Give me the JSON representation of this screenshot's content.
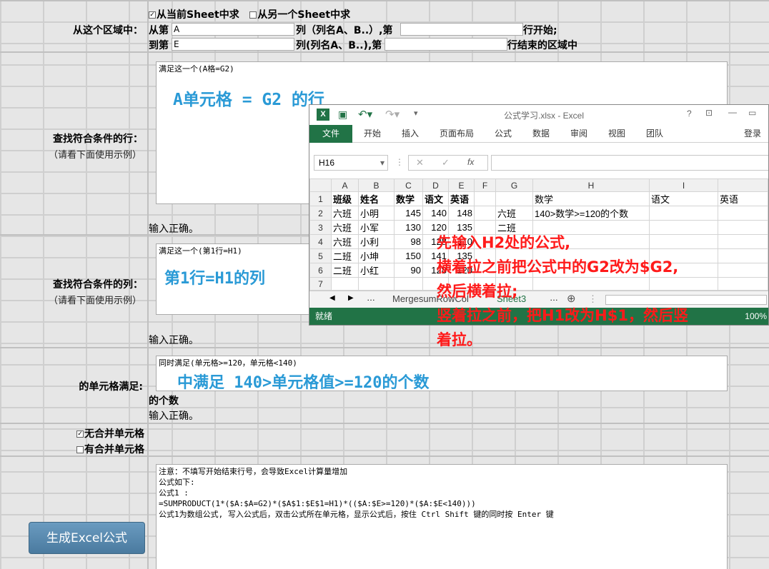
{
  "range": {
    "label": "从这个区域中：",
    "cb_current": "从当前Sheet中求",
    "cb_other": "从另一个Sheet中求",
    "from_prefix": "从第",
    "from_col": "A",
    "col_suffix_1": "列（列名A、B..）,第",
    "row_start": "行开始;",
    "to_prefix": "到第",
    "to_col": "E",
    "col_suffix_2": "列(列名A、B..),第",
    "row_end": "行结束的区域中"
  },
  "rows": {
    "label": "查找符合条件的行：",
    "hint": "（请看下面使用示例）",
    "textarea": "满足这一个(A格=G2)",
    "example": "A单元格 = G2 的行",
    "status": "输入正确。"
  },
  "cols": {
    "label": "查找符合条件的列：",
    "hint": "（请看下面使用示例）",
    "textarea": "满足这一个(第1行=H1)",
    "example": "第1行=H1的列",
    "status": "输入正确。"
  },
  "cells": {
    "label": "的单元格满足:",
    "textarea": "同时满足(单元格>=120，单元格<140)",
    "example": "中满足 140>单元格值>=120的个数",
    "count_label": "的个数",
    "status": "输入正确。"
  },
  "merge": {
    "no_merge": "无合并单元格",
    "has_merge": "有合并单元格"
  },
  "output": {
    "text": "注意：不填写开始结束行号，会导致Excel计算量增加\n公式如下:\n公式1 :\n=SUMPRODUCT(1*($A:$A=G2)*($A$1:$E$1=H1)*(($A:$E>=120)*($A:$E<140)))\n公式1为数组公式, 写入公式后，双击公式所在单元格，显示公式后，按住 Ctrl Shift 键的同时按 Enter 键",
    "button": "生成Excel公式"
  },
  "excel": {
    "title": "公式学习.xlsx - Excel",
    "tabs": [
      "文件",
      "开始",
      "插入",
      "页面布局",
      "公式",
      "数据",
      "审阅",
      "视图",
      "团队"
    ],
    "login": "登录",
    "namebox": "H16",
    "col_headers": [
      "A",
      "B",
      "C",
      "D",
      "E",
      "F",
      "G",
      "H",
      "I",
      ""
    ],
    "grid": [
      [
        "1",
        "班级",
        "姓名",
        "数学",
        "语文",
        "英语",
        "",
        "",
        "数学",
        "语文",
        "英语"
      ],
      [
        "2",
        "六班",
        "小明",
        "145",
        "140",
        "148",
        "",
        "六班",
        "140>数学>=120的个数",
        "",
        ""
      ],
      [
        "3",
        "六班",
        "小军",
        "130",
        "120",
        "135",
        "",
        "二班",
        "",
        "",
        ""
      ],
      [
        "4",
        "六班",
        "小利",
        "98",
        "128",
        "110",
        "",
        "",
        "",
        "",
        ""
      ],
      [
        "5",
        "二班",
        "小坤",
        "150",
        "141",
        "135",
        "",
        "",
        "",
        "",
        ""
      ],
      [
        "6",
        "二班",
        "小红",
        "90",
        "128",
        "120",
        "",
        "",
        "",
        "",
        ""
      ],
      [
        "7",
        "",
        "",
        "",
        "",
        "",
        "",
        "",
        "",
        "",
        ""
      ],
      [
        "8",
        "",
        "",
        "",
        "",
        "",
        "",
        "",
        "",
        "",
        ""
      ]
    ],
    "sheet1": "MergesumRowCol",
    "sheet2": "Sheet3",
    "ready": "就绪",
    "zoom": "100%"
  },
  "annotation": {
    "line1": "先输入H2处的公式,",
    "line2": "横着拉之前把公式中的G2改为$G2,",
    "line3": "然后横着拉;",
    "line4": "竖着拉之前，把H1改为H$1，然后竖",
    "line5": "着拉。"
  }
}
